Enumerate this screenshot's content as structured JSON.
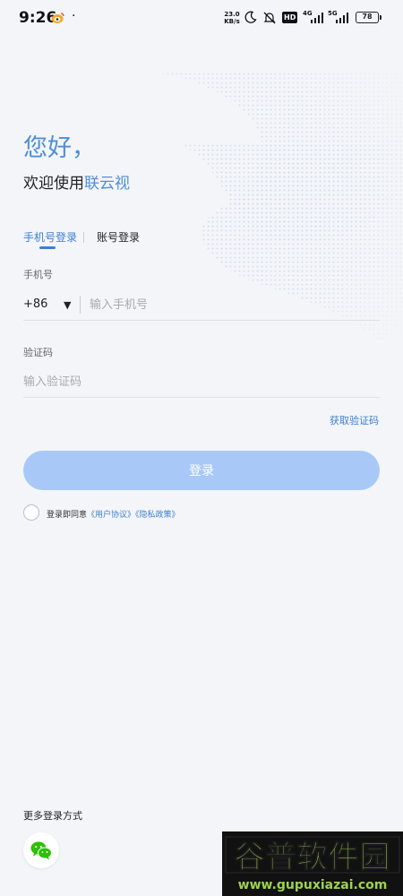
{
  "status_bar": {
    "time": "9:26",
    "dot": "·",
    "net_speed_value": "23.0",
    "net_speed_unit": "KB/s",
    "hd_badge": "HD",
    "net1": "4G",
    "net2": "5G",
    "battery": "78"
  },
  "header": {
    "greeting": "您好，",
    "welcome_prefix": "欢迎使用",
    "brand": "联云视"
  },
  "tabs": {
    "phone_login": "手机号登录",
    "account_login": "账号登录"
  },
  "phone": {
    "label": "手机号",
    "country_code": "+86",
    "dropdown_arrow": "▼",
    "placeholder": "输入手机号"
  },
  "code": {
    "label": "验证码",
    "placeholder": "输入验证码",
    "get_code": "获取验证码"
  },
  "login_button": "登录",
  "agreement": {
    "prefix": "登录即同意",
    "user_agreement": "《用户协议》",
    "privacy_policy": "《隐私政策》"
  },
  "more_login": {
    "label": "更多登录方式",
    "wechat_icon": "wechat-icon"
  },
  "watermark": {
    "title": "谷普软件园",
    "url": "www.gupuxiazai.com"
  },
  "colors": {
    "accent": "#3c7fd1",
    "greeting": "#4e8fd8",
    "button_disabled": "#a8c9f7",
    "background": "#f3f5f9",
    "wechat_green": "#2dc100"
  }
}
